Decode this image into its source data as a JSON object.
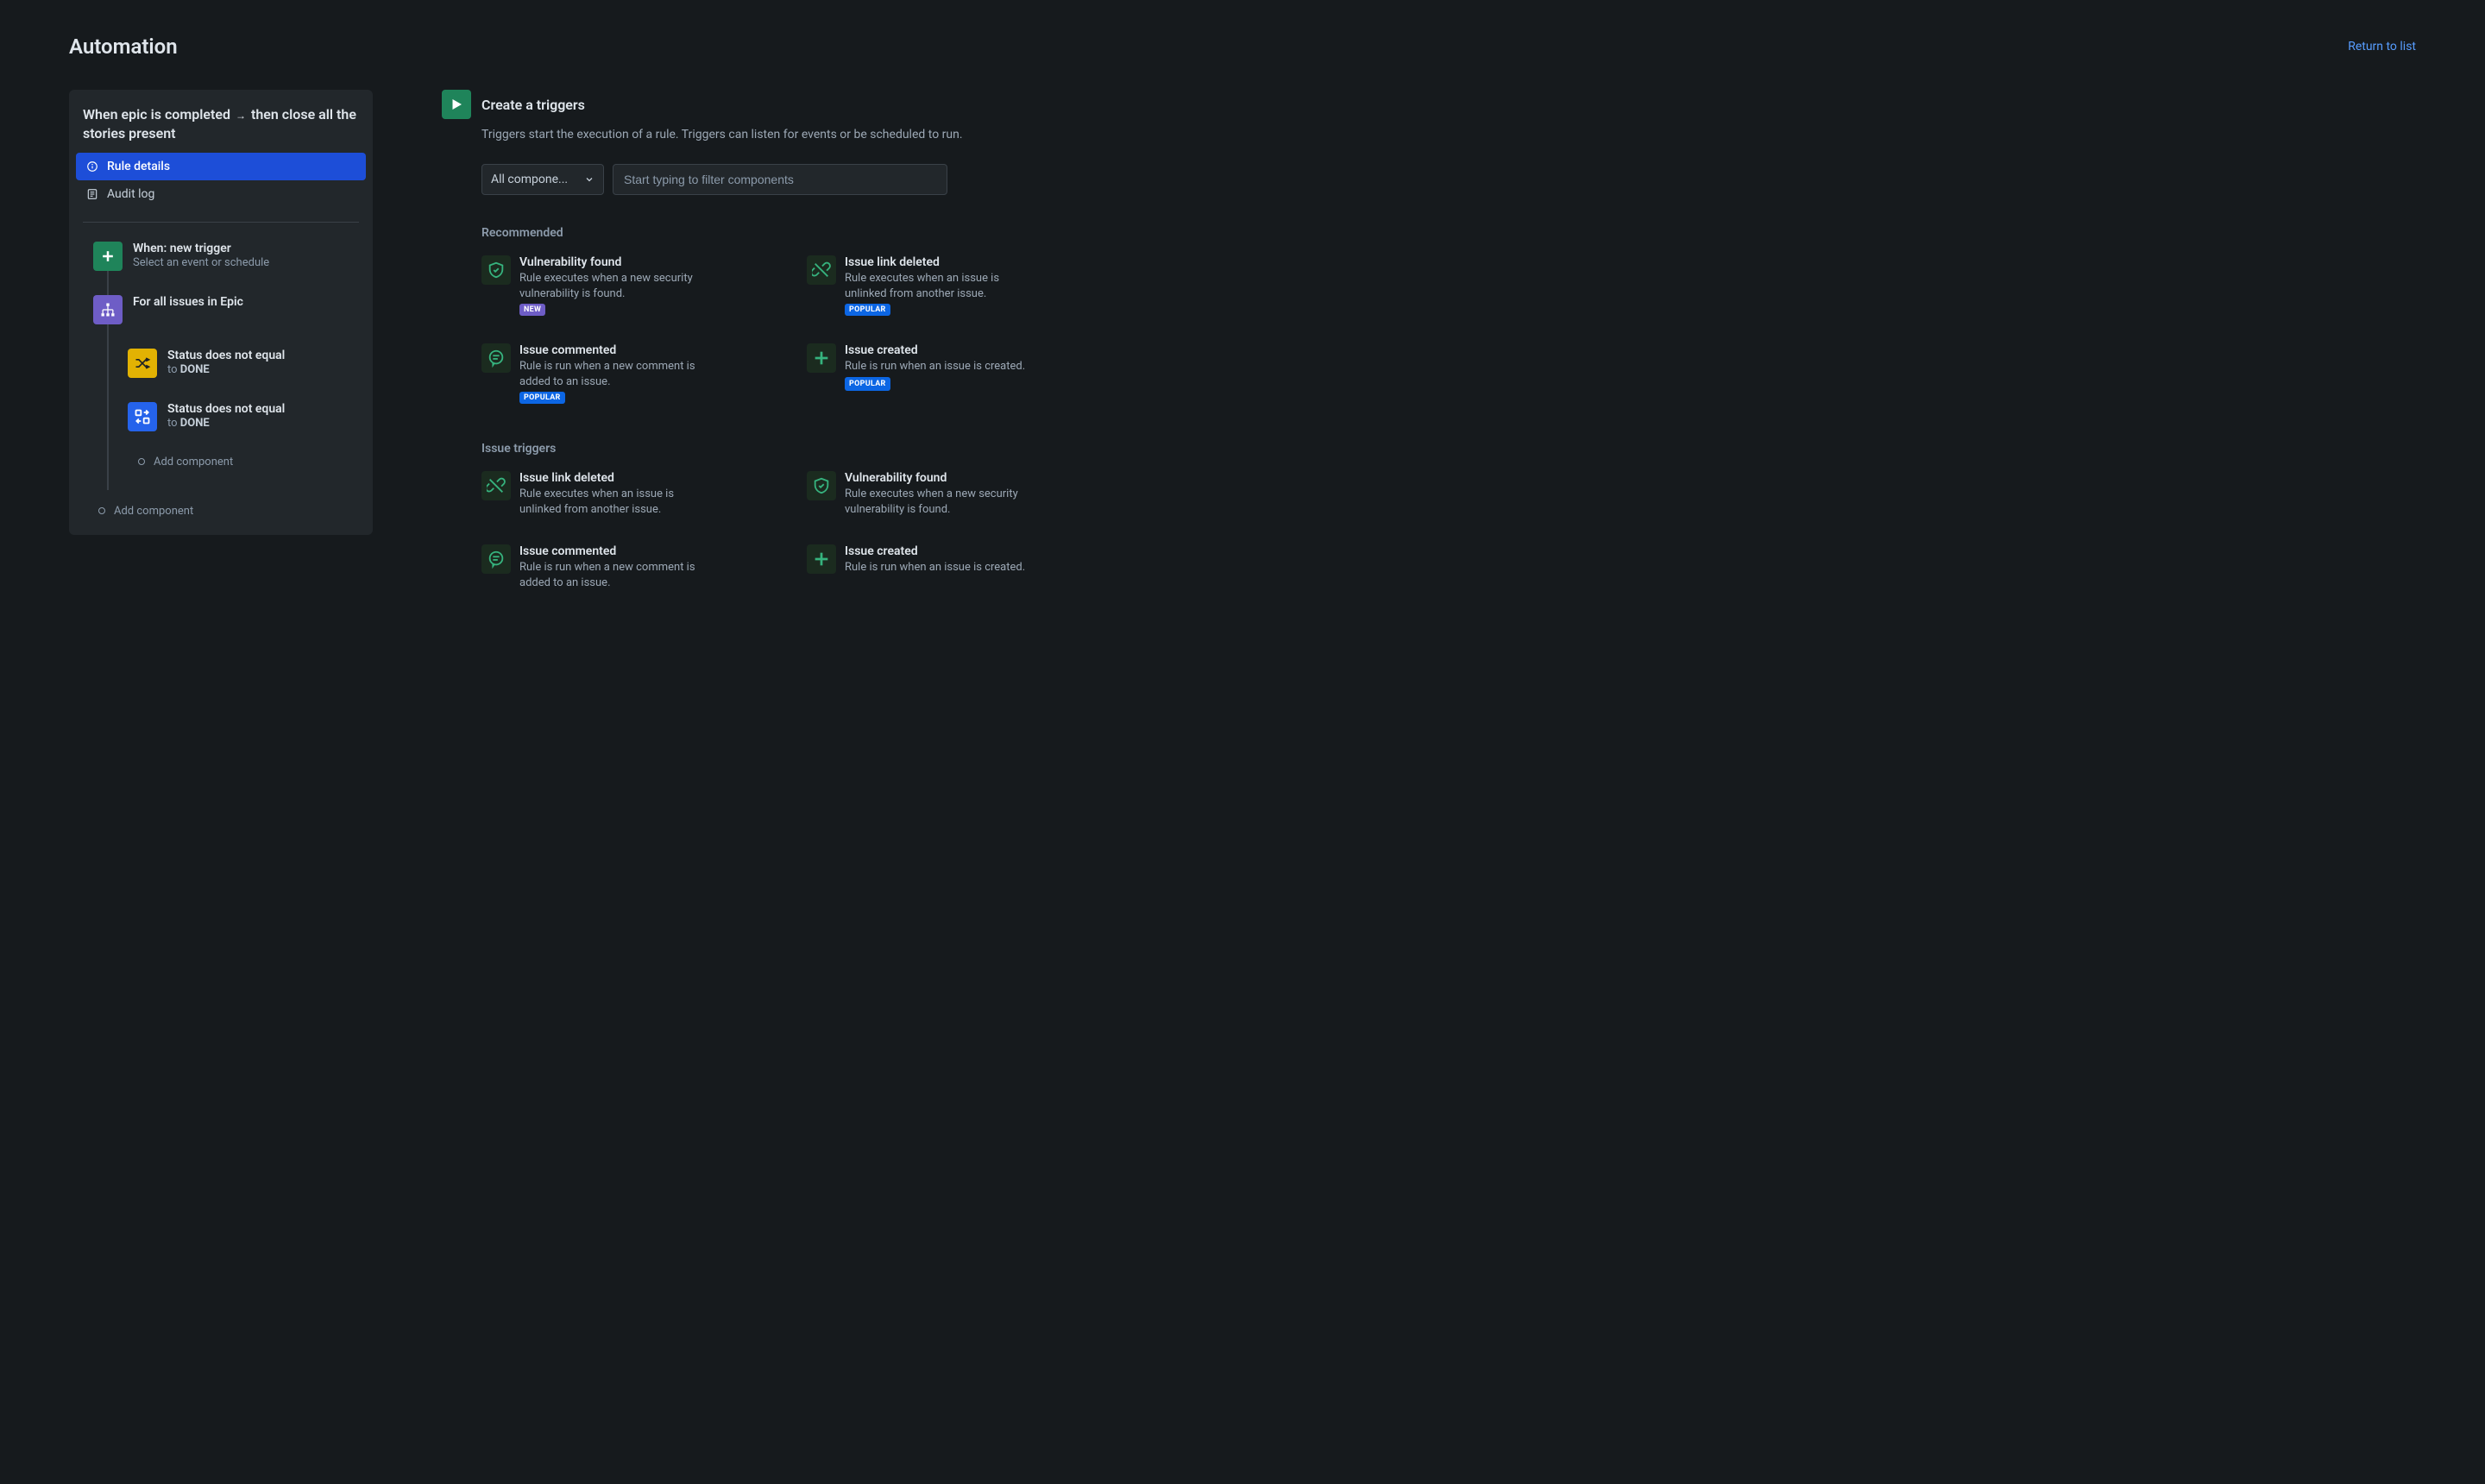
{
  "header": {
    "title": "Automation",
    "return_link": "Return to list"
  },
  "sidebar": {
    "rule_title_part1": "When epic is completed",
    "rule_title_part2": "then close all the stories present",
    "nav": {
      "rule_details": "Rule details",
      "audit_log": "Audit log"
    },
    "steps": {
      "trigger_title": "When: new trigger",
      "trigger_sub": "Select an event or schedule",
      "branch_title": "For all issues in Epic",
      "cond1_title": "Status does not equal",
      "cond1_to": "to",
      "cond1_val": "DONE",
      "cond2_title": "Status does not equal",
      "cond2_to": "to",
      "cond2_val": "DONE",
      "add_component": "Add component"
    }
  },
  "main": {
    "title": "Create a triggers",
    "desc": "Triggers start the execution of a rule. Triggers can listen for events or be scheduled to run.",
    "dropdown_label": "All compone...",
    "search_placeholder": "Start typing to filter components",
    "section_recommended": "Recommended",
    "section_issue": "Issue triggers",
    "badges": {
      "new": "NEW",
      "popular": "POPULAR"
    },
    "triggers": {
      "recommended": [
        {
          "title": "Vulnerability found",
          "desc": "Rule executes when a new security vulnerability is found.",
          "badge": "new",
          "icon": "shield"
        },
        {
          "title": "Issue link deleted",
          "desc": "Rule executes when an issue is unlinked from another issue.",
          "badge": "popular",
          "icon": "unlink"
        },
        {
          "title": "Issue commented",
          "desc": "Rule is run when a new comment is added to an issue.",
          "badge": "popular",
          "icon": "comment"
        },
        {
          "title": "Issue created",
          "desc": "Rule is run when an issue is created.",
          "badge": "popular",
          "icon": "plus"
        }
      ],
      "issue": [
        {
          "title": "Issue link deleted",
          "desc": "Rule executes when an issue is unlinked from another issue.",
          "icon": "unlink"
        },
        {
          "title": "Vulnerability found",
          "desc": "Rule executes when a new security vulnerability is found.",
          "icon": "shield"
        },
        {
          "title": "Issue commented",
          "desc": "Rule is run when a new comment is added to an issue.",
          "icon": "comment"
        },
        {
          "title": "Issue created",
          "desc": "Rule is run when an issue is created.",
          "icon": "plus"
        }
      ]
    }
  }
}
